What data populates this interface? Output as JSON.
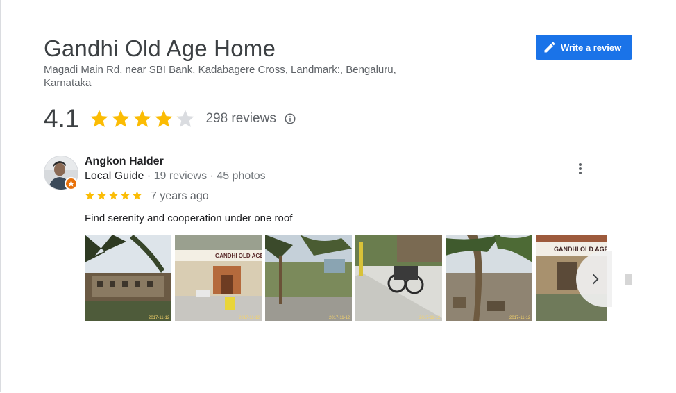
{
  "place": {
    "name": "Gandhi Old Age Home",
    "address": "Magadi Main Rd, near SBI Bank, Kadabagere Cross, Landmark:, Bengaluru, Karnataka",
    "rating": "4.1",
    "rating_value": 4.1,
    "max_stars": 5,
    "review_count": "298 reviews"
  },
  "actions": {
    "write_review_label": "Write a review",
    "write_review_icon": "pencil-icon",
    "next_photos_icon": "chevron-right-icon",
    "more_options_icon": "more-vert-icon",
    "info_icon": "info-icon"
  },
  "review": {
    "author": "Angkon Halder",
    "author_role": "Local Guide",
    "author_stats": " · 19 reviews · 45 photos",
    "rating_value": 5,
    "time": "7 years ago",
    "text": "Find serenity and cooperation under one roof",
    "photos": [
      {
        "name": "photo-1",
        "stamp": "2017-11-12"
      },
      {
        "name": "photo-2",
        "stamp": "2017-11-12",
        "sign": "GANDHI OLD AGE H"
      },
      {
        "name": "photo-3",
        "stamp": "2017-11-12"
      },
      {
        "name": "photo-4",
        "stamp": "2017-11-12"
      },
      {
        "name": "photo-5",
        "stamp": "2017-11-12"
      },
      {
        "name": "photo-6",
        "stamp": "",
        "sign": "GANDHI OLD AGE"
      }
    ]
  },
  "colors": {
    "accent": "#1a73e8",
    "star_filled": "#fbbc04",
    "star_empty": "#dadce0",
    "badge": "#e8710a"
  }
}
